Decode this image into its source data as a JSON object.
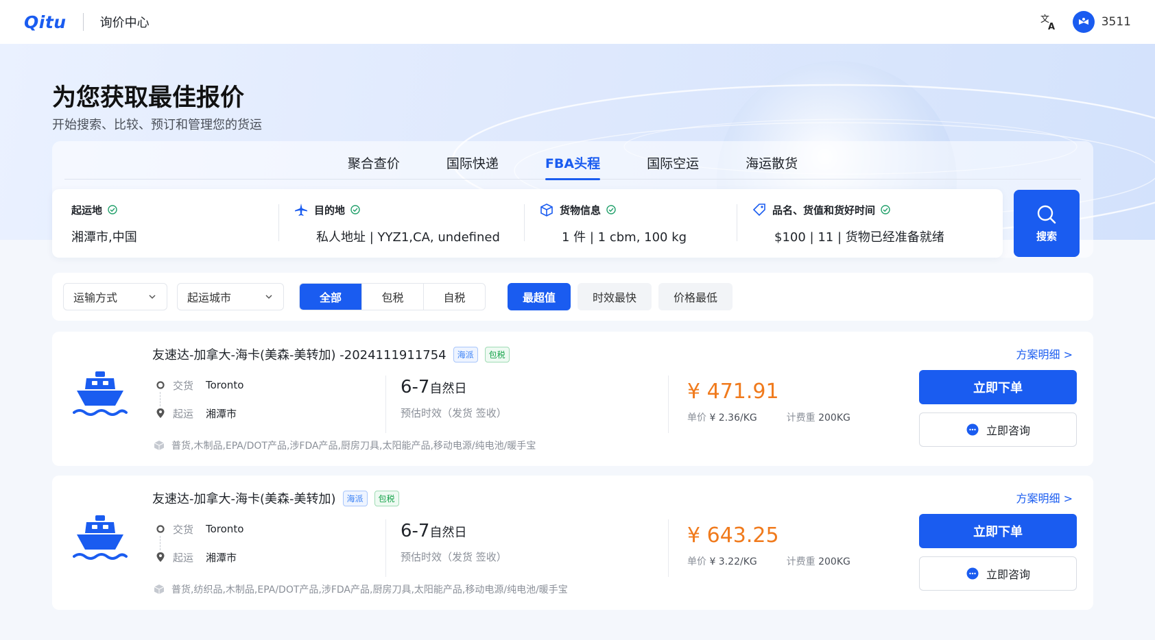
{
  "header": {
    "logo": "Qitu",
    "app_title": "询价中心",
    "user_name": "3511"
  },
  "hero": {
    "title": "为您获取最佳报价",
    "subtitle": "开始搜索、比较、预订和管理您的货运"
  },
  "tabs": [
    {
      "label": "聚合查价",
      "active": false
    },
    {
      "label": "国际快递",
      "active": false
    },
    {
      "label": "FBA头程",
      "active": true
    },
    {
      "label": "国际空运",
      "active": false
    },
    {
      "label": "海运散货",
      "active": false
    }
  ],
  "search": {
    "origin": {
      "label": "起运地",
      "value": "湘潭市,中国"
    },
    "destination": {
      "label": "目的地",
      "value": "私人地址 | YYZ1,CA, undefined"
    },
    "cargo": {
      "label": "货物信息",
      "value": "1 件 | 1 cbm,  100 kg"
    },
    "goods": {
      "label": "品名、货值和货好时间",
      "value": "$100 | 11 | 货物已经准备就绪"
    },
    "button_label": "搜索"
  },
  "filters": {
    "transport_mode": "运输方式",
    "origin_city": "起运城市",
    "tax_options": [
      {
        "label": "全部",
        "active": true
      },
      {
        "label": "包税",
        "active": false
      },
      {
        "label": "自税",
        "active": false
      }
    ],
    "sort_options": [
      {
        "label": "最超值",
        "active": true
      },
      {
        "label": "时效最快",
        "active": false
      },
      {
        "label": "价格最低",
        "active": false
      }
    ]
  },
  "results": [
    {
      "title": "友速达-加拿大-海卡(美森-美转加) -2024111911754",
      "tags": [
        "海派",
        "包税"
      ],
      "detail_link": "方案明细 >",
      "delivery_label": "交货",
      "delivery_city": "Toronto",
      "origin_label": "起运",
      "origin_city": "湘潭市",
      "eta_range": "6-7",
      "eta_unit": "自然日",
      "eta_note": "预估时效（发货 签收）",
      "price": "¥ 471.91",
      "unit_price_label": "单价",
      "unit_price": "¥ 2.36/KG",
      "weight_label": "计费重",
      "weight": "200KG",
      "cargo_types": "普货,木制品,EPA/DOT产品,涉FDA产品,厨房刀具,太阳能产品,移动电源/纯电池/暖手宝",
      "order_label": "立即下单",
      "consult_label": "立即咨询"
    },
    {
      "title": "友速达-加拿大-海卡(美森-美转加)",
      "tags": [
        "海派",
        "包税"
      ],
      "detail_link": "方案明细 >",
      "delivery_label": "交货",
      "delivery_city": "Toronto",
      "origin_label": "起运",
      "origin_city": "湘潭市",
      "eta_range": "6-7",
      "eta_unit": "自然日",
      "eta_note": "预估时效（发货 签收）",
      "price": "¥ 643.25",
      "unit_price_label": "单价",
      "unit_price": "¥ 3.22/KG",
      "weight_label": "计费重",
      "weight": "200KG",
      "cargo_types": "普货,纺织品,木制品,EPA/DOT产品,涉FDA产品,厨房刀具,太阳能产品,移动电源/纯电池/暖手宝",
      "order_label": "立即下单",
      "consult_label": "立即咨询"
    }
  ],
  "colors": {
    "primary": "#1a5cf0",
    "price": "#f07a1c",
    "tag_blue": "#3b82f6",
    "tag_green": "#16a34a",
    "check_green": "#22a06b"
  },
  "icons": [
    "translate-icon",
    "user-avatar-icon",
    "check-circle-icon",
    "plane-icon",
    "box-icon",
    "tag-icon",
    "search-icon",
    "chevron-down-icon",
    "ship-icon",
    "location-pin-icon",
    "cargo-box-icon",
    "chat-icon"
  ]
}
